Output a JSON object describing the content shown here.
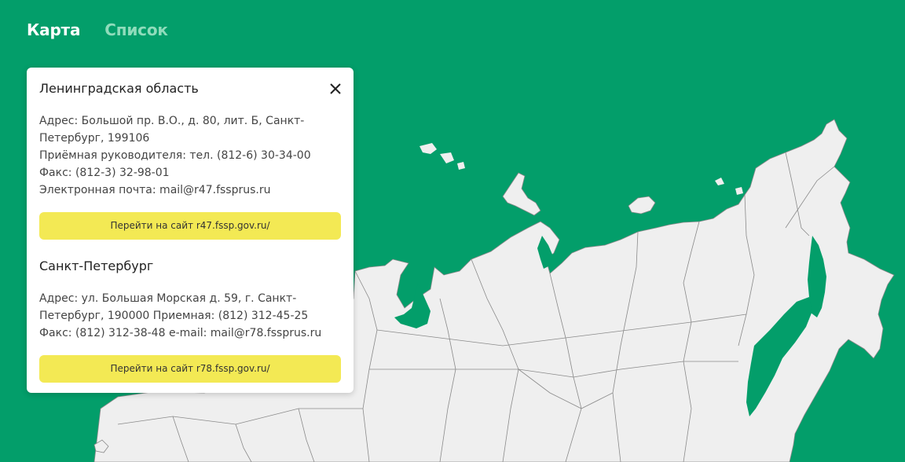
{
  "tabs": {
    "map_label": "Карта",
    "list_label": "Список",
    "active": "map"
  },
  "colors": {
    "background": "#039e6a",
    "land": "#efefef",
    "borders": "#8a8a8a",
    "button": "#f3e954",
    "tab_inactive": "#8fdcbb"
  },
  "panel": {
    "close_icon": "close-icon",
    "offices": [
      {
        "title": "Ленинградская область",
        "lines": [
          "Адрес: Большой пр. В.О., д. 80, лит. Б, Санкт-",
          "Петербург, 199106",
          "Приёмная руководителя: тел. (812-6) 30-34-00",
          "Факс: (812-3) 32-98-01",
          "Электронная почта: mail@r47.fssprus.ru"
        ],
        "button_label": "Перейти на сайт r47.fssp.gov.ru/"
      },
      {
        "title": "Санкт-Петербург",
        "lines": [
          "Адрес: ул. Большая Морская д. 59, г. Санкт-",
          "Петербург, 190000 Приемная: (812) 312-45-25",
          "Факс: (812) 312-38-48 e-mail: mail@r78.fssprus.ru"
        ],
        "button_label": "Перейти на сайт r78.fssp.gov.ru/"
      }
    ]
  }
}
